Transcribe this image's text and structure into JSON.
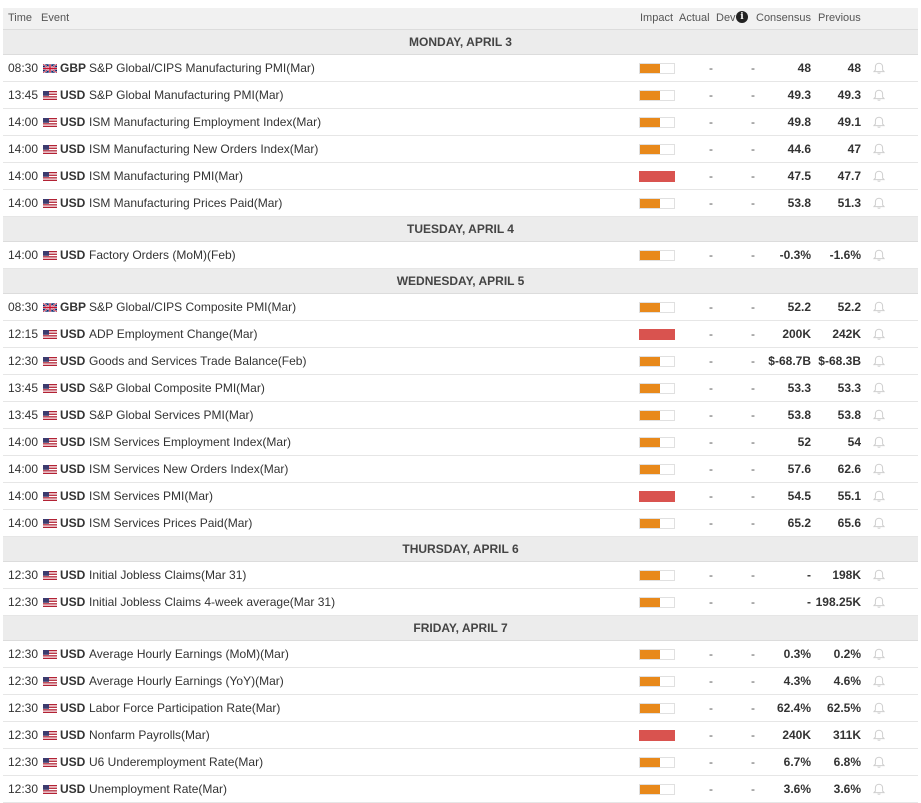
{
  "header": {
    "time": "Time",
    "event": "Event",
    "impact": "Impact",
    "actual": "Actual",
    "dev": "Dev",
    "info_icon": "i",
    "consensus": "Consensus",
    "previous": "Previous"
  },
  "colors": {
    "medium_impact": "#e8891b",
    "high_impact": "#d9534f"
  },
  "days": [
    {
      "label": "MONDAY, APRIL 3",
      "events": [
        {
          "time": "08:30",
          "flag": "uk-flag-icon",
          "currency": "GBP",
          "event": "S&P Global/CIPS Manufacturing PMI(Mar)",
          "impact": "medium",
          "actual": "-",
          "dev": "-",
          "consensus": "48",
          "previous": "48"
        },
        {
          "time": "13:45",
          "flag": "us-flag-icon",
          "currency": "USD",
          "event": "S&P Global Manufacturing PMI(Mar)",
          "impact": "medium",
          "actual": "-",
          "dev": "-",
          "consensus": "49.3",
          "previous": "49.3"
        },
        {
          "time": "14:00",
          "flag": "us-flag-icon",
          "currency": "USD",
          "event": "ISM Manufacturing Employment Index(Mar)",
          "impact": "medium",
          "actual": "-",
          "dev": "-",
          "consensus": "49.8",
          "previous": "49.1"
        },
        {
          "time": "14:00",
          "flag": "us-flag-icon",
          "currency": "USD",
          "event": "ISM Manufacturing New Orders Index(Mar)",
          "impact": "medium",
          "actual": "-",
          "dev": "-",
          "consensus": "44.6",
          "previous": "47"
        },
        {
          "time": "14:00",
          "flag": "us-flag-icon",
          "currency": "USD",
          "event": "ISM Manufacturing PMI(Mar)",
          "impact": "high",
          "actual": "-",
          "dev": "-",
          "consensus": "47.5",
          "previous": "47.7"
        },
        {
          "time": "14:00",
          "flag": "us-flag-icon",
          "currency": "USD",
          "event": "ISM Manufacturing Prices Paid(Mar)",
          "impact": "medium",
          "actual": "-",
          "dev": "-",
          "consensus": "53.8",
          "previous": "51.3"
        }
      ]
    },
    {
      "label": "TUESDAY, APRIL 4",
      "events": [
        {
          "time": "14:00",
          "flag": "us-flag-icon",
          "currency": "USD",
          "event": "Factory Orders (MoM)(Feb)",
          "impact": "medium",
          "actual": "-",
          "dev": "-",
          "consensus": "-0.3%",
          "previous": "-1.6%"
        }
      ]
    },
    {
      "label": "WEDNESDAY, APRIL 5",
      "events": [
        {
          "time": "08:30",
          "flag": "uk-flag-icon",
          "currency": "GBP",
          "event": "S&P Global/CIPS Composite PMI(Mar)",
          "impact": "medium",
          "actual": "-",
          "dev": "-",
          "consensus": "52.2",
          "previous": "52.2"
        },
        {
          "time": "12:15",
          "flag": "us-flag-icon",
          "currency": "USD",
          "event": "ADP Employment Change(Mar)",
          "impact": "high",
          "actual": "-",
          "dev": "-",
          "consensus": "200K",
          "previous": "242K"
        },
        {
          "time": "12:30",
          "flag": "us-flag-icon",
          "currency": "USD",
          "event": "Goods and Services Trade Balance(Feb)",
          "impact": "medium",
          "actual": "-",
          "dev": "-",
          "consensus": "$-68.7B",
          "previous": "$-68.3B"
        },
        {
          "time": "13:45",
          "flag": "us-flag-icon",
          "currency": "USD",
          "event": "S&P Global Composite PMI(Mar)",
          "impact": "medium",
          "actual": "-",
          "dev": "-",
          "consensus": "53.3",
          "previous": "53.3"
        },
        {
          "time": "13:45",
          "flag": "us-flag-icon",
          "currency": "USD",
          "event": "S&P Global Services PMI(Mar)",
          "impact": "medium",
          "actual": "-",
          "dev": "-",
          "consensus": "53.8",
          "previous": "53.8"
        },
        {
          "time": "14:00",
          "flag": "us-flag-icon",
          "currency": "USD",
          "event": "ISM Services Employment Index(Mar)",
          "impact": "medium",
          "actual": "-",
          "dev": "-",
          "consensus": "52",
          "previous": "54"
        },
        {
          "time": "14:00",
          "flag": "us-flag-icon",
          "currency": "USD",
          "event": "ISM Services New Orders Index(Mar)",
          "impact": "medium",
          "actual": "-",
          "dev": "-",
          "consensus": "57.6",
          "previous": "62.6"
        },
        {
          "time": "14:00",
          "flag": "us-flag-icon",
          "currency": "USD",
          "event": "ISM Services PMI(Mar)",
          "impact": "high",
          "actual": "-",
          "dev": "-",
          "consensus": "54.5",
          "previous": "55.1"
        },
        {
          "time": "14:00",
          "flag": "us-flag-icon",
          "currency": "USD",
          "event": "ISM Services Prices Paid(Mar)",
          "impact": "medium",
          "actual": "-",
          "dev": "-",
          "consensus": "65.2",
          "previous": "65.6"
        }
      ]
    },
    {
      "label": "THURSDAY, APRIL 6",
      "events": [
        {
          "time": "12:30",
          "flag": "us-flag-icon",
          "currency": "USD",
          "event": "Initial Jobless Claims(Mar 31)",
          "impact": "medium",
          "actual": "-",
          "dev": "-",
          "consensus": "-",
          "previous": "198K"
        },
        {
          "time": "12:30",
          "flag": "us-flag-icon",
          "currency": "USD",
          "event": "Initial Jobless Claims 4-week average(Mar 31)",
          "impact": "medium",
          "actual": "-",
          "dev": "-",
          "consensus": "-",
          "previous": "198.25K"
        }
      ]
    },
    {
      "label": "FRIDAY, APRIL 7",
      "events": [
        {
          "time": "12:30",
          "flag": "us-flag-icon",
          "currency": "USD",
          "event": "Average Hourly Earnings (MoM)(Mar)",
          "impact": "medium",
          "actual": "-",
          "dev": "-",
          "consensus": "0.3%",
          "previous": "0.2%"
        },
        {
          "time": "12:30",
          "flag": "us-flag-icon",
          "currency": "USD",
          "event": "Average Hourly Earnings (YoY)(Mar)",
          "impact": "medium",
          "actual": "-",
          "dev": "-",
          "consensus": "4.3%",
          "previous": "4.6%"
        },
        {
          "time": "12:30",
          "flag": "us-flag-icon",
          "currency": "USD",
          "event": "Labor Force Participation Rate(Mar)",
          "impact": "medium",
          "actual": "-",
          "dev": "-",
          "consensus": "62.4%",
          "previous": "62.5%"
        },
        {
          "time": "12:30",
          "flag": "us-flag-icon",
          "currency": "USD",
          "event": "Nonfarm Payrolls(Mar)",
          "impact": "high",
          "actual": "-",
          "dev": "-",
          "consensus": "240K",
          "previous": "311K"
        },
        {
          "time": "12:30",
          "flag": "us-flag-icon",
          "currency": "USD",
          "event": "U6 Underemployment Rate(Mar)",
          "impact": "medium",
          "actual": "-",
          "dev": "-",
          "consensus": "6.7%",
          "previous": "6.8%"
        },
        {
          "time": "12:30",
          "flag": "us-flag-icon",
          "currency": "USD",
          "event": "Unemployment Rate(Mar)",
          "impact": "medium",
          "actual": "-",
          "dev": "-",
          "consensus": "3.6%",
          "previous": "3.6%"
        }
      ]
    }
  ]
}
